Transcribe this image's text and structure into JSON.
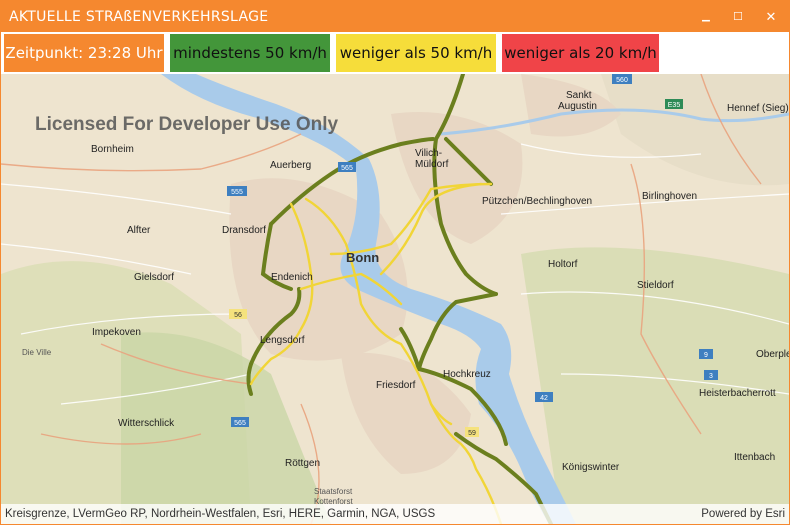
{
  "window": {
    "title": "AKTUELLE STRAßENVERKEHRSLAGE",
    "controls": {
      "minimize": "▁",
      "maximize": "☐",
      "close": "✕"
    }
  },
  "legend": {
    "time_label": "Zeitpunkt: 23:28 Uhr",
    "green_label": "mindestens 50 km/h",
    "yellow_label": "weniger als 50 km/h",
    "red_label": "weniger als 20 km/h",
    "colors": {
      "time": "#F5882F",
      "green": "#43963A",
      "yellow": "#F6DD3A",
      "red": "#F04448"
    }
  },
  "map": {
    "watermark": "Licensed For Developer Use Only",
    "places": {
      "bonn": "Bonn",
      "bornheim": "Bornheim",
      "auerberg": "Auerberg",
      "vilich": "Vilich-",
      "vilich2": "Müldorf",
      "sankt": "Sankt",
      "augustin": "Augustin",
      "hennef": "Hennef (Sieg)",
      "alfter": "Alfter",
      "dransdorf": "Dransdorf",
      "puetzchen": "Pützchen/Bechlinghoven",
      "birlinghoven": "Birlinghoven",
      "gielsdorf": "Gielsdorf",
      "endenich": "Endenich",
      "holtorf": "Holtorf",
      "stieldorf": "Stieldorf",
      "impekoven": "Impekoven",
      "lengsdorf": "Lengsdorf",
      "dieville": "Die Ville",
      "oberple": "Oberple",
      "friesdorf": "Friesdorf",
      "hochkreuz": "Hochkreuz",
      "heisterbacherrott": "Heisterbacherrott",
      "witterschlick": "Witterschlick",
      "ittenbach": "Ittenbach",
      "koenigswinter": "Königswinter",
      "roettgen": "Röttgen",
      "staatsforst": "Staatsforst",
      "kottenforst": "Kottenforst"
    },
    "shields": [
      "560",
      "E35",
      "555",
      "565",
      "56",
      "59",
      "42",
      "9",
      "3",
      "565"
    ],
    "attribution": "Kreisgrenze, LVermGeo RP, Nordrhein-Westfalen, Esri, HERE, Garmin, NGA, USGS",
    "powered_by": "Powered by Esri"
  }
}
